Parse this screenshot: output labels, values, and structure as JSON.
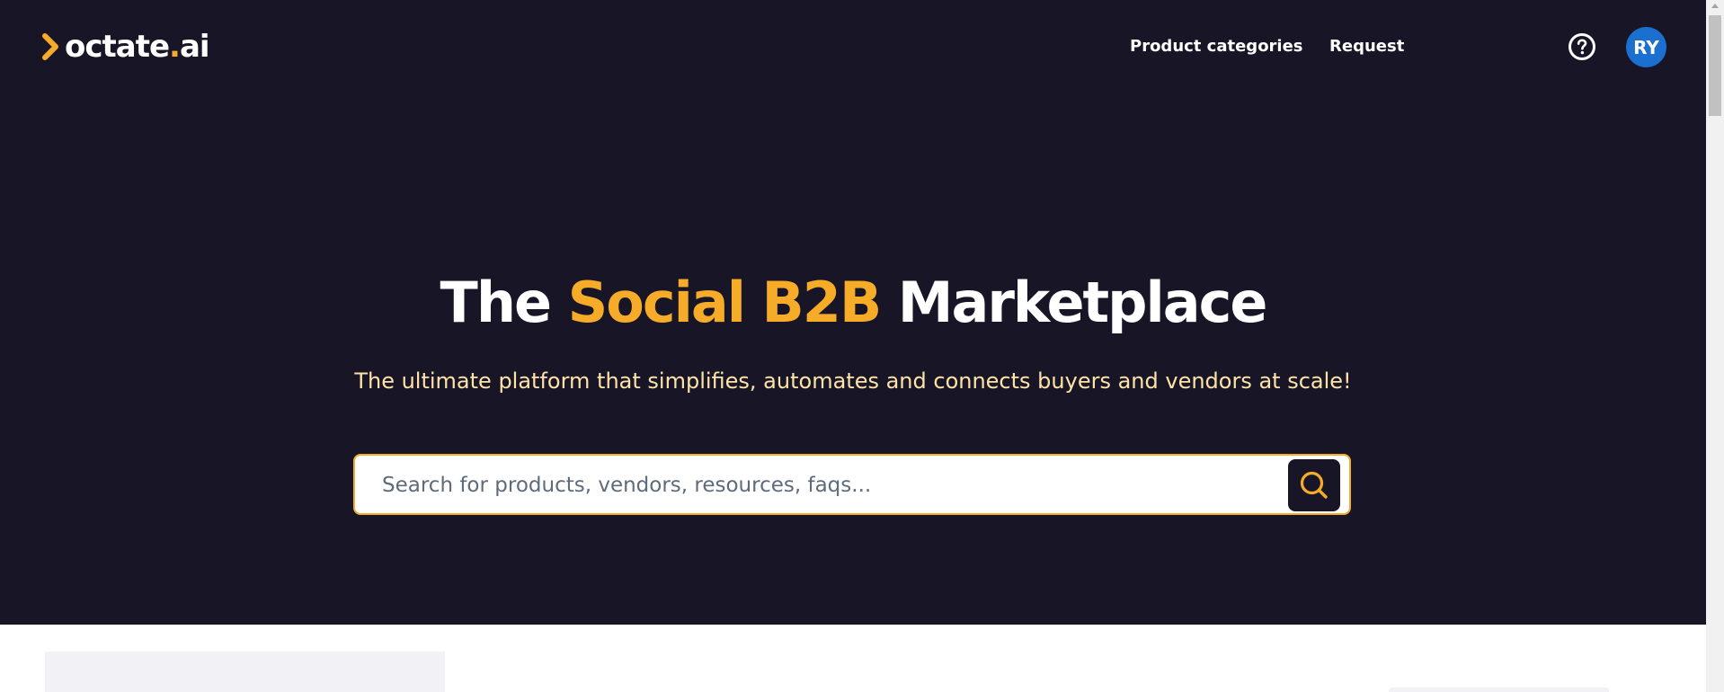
{
  "header": {
    "logo_text": "octate",
    "logo_dot": ".",
    "logo_suffix": "ai",
    "nav": {
      "categories_label": "Product categories",
      "request_label": "Request"
    },
    "help_icon": "question-circle-icon",
    "avatar_initials": "RY"
  },
  "hero": {
    "headline_prefix": "The ",
    "headline_accent": "Social B2B",
    "headline_suffix": " Marketplace",
    "subheadline": "The ultimate platform that simplifies, automates and connects buyers and vendors at scale!",
    "search": {
      "placeholder": "Search for products, vendors, resources, faqs...",
      "value": "",
      "button_icon": "search-icon"
    }
  },
  "colors": {
    "hero_bg": "#181626",
    "accent": "#f6ac28",
    "subheadline": "#fde3a7",
    "avatar_bg": "#1a6fcf"
  }
}
